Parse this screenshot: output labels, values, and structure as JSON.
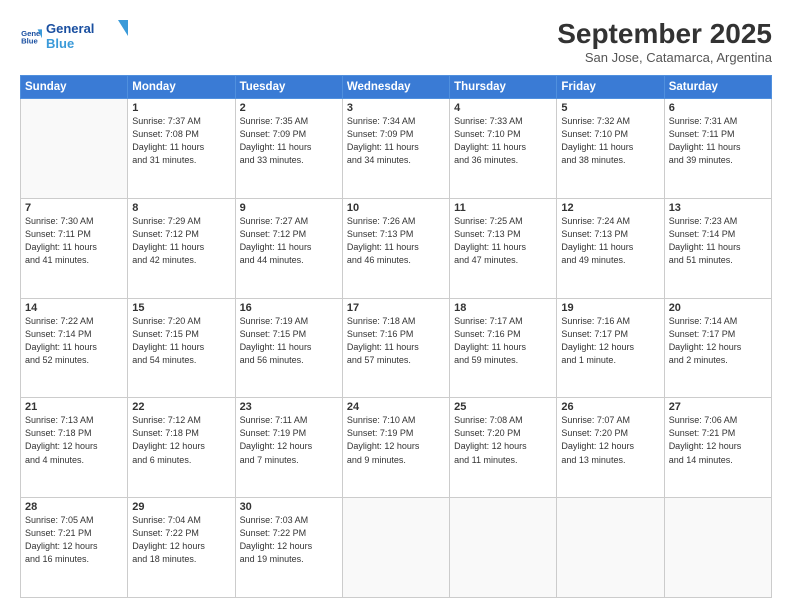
{
  "header": {
    "logo_line1": "General",
    "logo_line2": "Blue",
    "month": "September 2025",
    "location": "San Jose, Catamarca, Argentina"
  },
  "days_of_week": [
    "Sunday",
    "Monday",
    "Tuesday",
    "Wednesday",
    "Thursday",
    "Friday",
    "Saturday"
  ],
  "weeks": [
    [
      {
        "day": "",
        "info": ""
      },
      {
        "day": "1",
        "info": "Sunrise: 7:37 AM\nSunset: 7:08 PM\nDaylight: 11 hours\nand 31 minutes."
      },
      {
        "day": "2",
        "info": "Sunrise: 7:35 AM\nSunset: 7:09 PM\nDaylight: 11 hours\nand 33 minutes."
      },
      {
        "day": "3",
        "info": "Sunrise: 7:34 AM\nSunset: 7:09 PM\nDaylight: 11 hours\nand 34 minutes."
      },
      {
        "day": "4",
        "info": "Sunrise: 7:33 AM\nSunset: 7:10 PM\nDaylight: 11 hours\nand 36 minutes."
      },
      {
        "day": "5",
        "info": "Sunrise: 7:32 AM\nSunset: 7:10 PM\nDaylight: 11 hours\nand 38 minutes."
      },
      {
        "day": "6",
        "info": "Sunrise: 7:31 AM\nSunset: 7:11 PM\nDaylight: 11 hours\nand 39 minutes."
      }
    ],
    [
      {
        "day": "7",
        "info": "Sunrise: 7:30 AM\nSunset: 7:11 PM\nDaylight: 11 hours\nand 41 minutes."
      },
      {
        "day": "8",
        "info": "Sunrise: 7:29 AM\nSunset: 7:12 PM\nDaylight: 11 hours\nand 42 minutes."
      },
      {
        "day": "9",
        "info": "Sunrise: 7:27 AM\nSunset: 7:12 PM\nDaylight: 11 hours\nand 44 minutes."
      },
      {
        "day": "10",
        "info": "Sunrise: 7:26 AM\nSunset: 7:13 PM\nDaylight: 11 hours\nand 46 minutes."
      },
      {
        "day": "11",
        "info": "Sunrise: 7:25 AM\nSunset: 7:13 PM\nDaylight: 11 hours\nand 47 minutes."
      },
      {
        "day": "12",
        "info": "Sunrise: 7:24 AM\nSunset: 7:13 PM\nDaylight: 11 hours\nand 49 minutes."
      },
      {
        "day": "13",
        "info": "Sunrise: 7:23 AM\nSunset: 7:14 PM\nDaylight: 11 hours\nand 51 minutes."
      }
    ],
    [
      {
        "day": "14",
        "info": "Sunrise: 7:22 AM\nSunset: 7:14 PM\nDaylight: 11 hours\nand 52 minutes."
      },
      {
        "day": "15",
        "info": "Sunrise: 7:20 AM\nSunset: 7:15 PM\nDaylight: 11 hours\nand 54 minutes."
      },
      {
        "day": "16",
        "info": "Sunrise: 7:19 AM\nSunset: 7:15 PM\nDaylight: 11 hours\nand 56 minutes."
      },
      {
        "day": "17",
        "info": "Sunrise: 7:18 AM\nSunset: 7:16 PM\nDaylight: 11 hours\nand 57 minutes."
      },
      {
        "day": "18",
        "info": "Sunrise: 7:17 AM\nSunset: 7:16 PM\nDaylight: 11 hours\nand 59 minutes."
      },
      {
        "day": "19",
        "info": "Sunrise: 7:16 AM\nSunset: 7:17 PM\nDaylight: 12 hours\nand 1 minute."
      },
      {
        "day": "20",
        "info": "Sunrise: 7:14 AM\nSunset: 7:17 PM\nDaylight: 12 hours\nand 2 minutes."
      }
    ],
    [
      {
        "day": "21",
        "info": "Sunrise: 7:13 AM\nSunset: 7:18 PM\nDaylight: 12 hours\nand 4 minutes."
      },
      {
        "day": "22",
        "info": "Sunrise: 7:12 AM\nSunset: 7:18 PM\nDaylight: 12 hours\nand 6 minutes."
      },
      {
        "day": "23",
        "info": "Sunrise: 7:11 AM\nSunset: 7:19 PM\nDaylight: 12 hours\nand 7 minutes."
      },
      {
        "day": "24",
        "info": "Sunrise: 7:10 AM\nSunset: 7:19 PM\nDaylight: 12 hours\nand 9 minutes."
      },
      {
        "day": "25",
        "info": "Sunrise: 7:08 AM\nSunset: 7:20 PM\nDaylight: 12 hours\nand 11 minutes."
      },
      {
        "day": "26",
        "info": "Sunrise: 7:07 AM\nSunset: 7:20 PM\nDaylight: 12 hours\nand 13 minutes."
      },
      {
        "day": "27",
        "info": "Sunrise: 7:06 AM\nSunset: 7:21 PM\nDaylight: 12 hours\nand 14 minutes."
      }
    ],
    [
      {
        "day": "28",
        "info": "Sunrise: 7:05 AM\nSunset: 7:21 PM\nDaylight: 12 hours\nand 16 minutes."
      },
      {
        "day": "29",
        "info": "Sunrise: 7:04 AM\nSunset: 7:22 PM\nDaylight: 12 hours\nand 18 minutes."
      },
      {
        "day": "30",
        "info": "Sunrise: 7:03 AM\nSunset: 7:22 PM\nDaylight: 12 hours\nand 19 minutes."
      },
      {
        "day": "",
        "info": ""
      },
      {
        "day": "",
        "info": ""
      },
      {
        "day": "",
        "info": ""
      },
      {
        "day": "",
        "info": ""
      }
    ]
  ]
}
